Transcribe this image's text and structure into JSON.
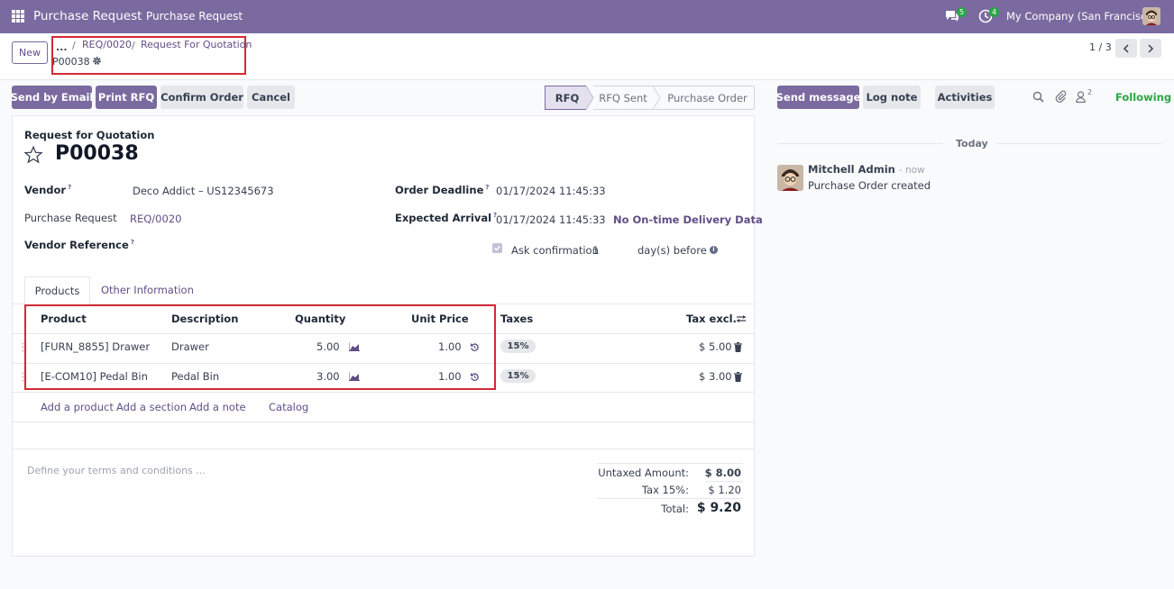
{
  "navbar": {
    "app_title": "Purchase Request",
    "menu_item": "Purchase Request",
    "chat_count": "5",
    "activity_count": "4",
    "company": "My Company (San Francisco)",
    "color": "#7a6a9f"
  },
  "control": {
    "new_label": "New",
    "breadcrumb_dots": "...",
    "breadcrumb_sep": "/",
    "breadcrumb_req": "REQ/0020",
    "breadcrumb_rfq": "Request For Quotation",
    "current_record": "P00038",
    "pager": "1 / 3"
  },
  "actions": {
    "send_email": "Send by Email",
    "print_rfq": "Print RFQ",
    "confirm_order": "Confirm Order",
    "cancel": "Cancel"
  },
  "stages": [
    "RFQ",
    "RFQ Sent",
    "Purchase Order"
  ],
  "form": {
    "subtitle": "Request for Quotation",
    "title": "P00038",
    "vendor_label": "Vendor",
    "vendor_value": "Deco Addict – US12345673",
    "purchase_request_label": "Purchase Request",
    "purchase_request_value": "REQ/0020",
    "vendor_reference_label": "Vendor Reference",
    "order_deadline_label": "Order Deadline",
    "order_deadline_value": "01/17/2024 11:45:33",
    "expected_arrival_label": "Expected Arrival",
    "expected_arrival_value": "01/17/2024 11:45:33",
    "delivery_data_link": "No On-time Delivery Data",
    "ask_confirmation_label": "Ask confirmation",
    "ask_confirmation_days": "1",
    "days_before": "day(s) before",
    "help_mark": "?"
  },
  "tabs": {
    "products": "Products",
    "other_info": "Other Information"
  },
  "table": {
    "headers": {
      "product": "Product",
      "description": "Description",
      "quantity": "Quantity",
      "unit_price": "Unit Price",
      "taxes": "Taxes",
      "tax_excl": "Tax excl."
    },
    "rows": [
      {
        "product": "[FURN_8855] Drawer",
        "description": "Drawer",
        "quantity": "5.00",
        "unit_price": "1.00",
        "tax": "15%",
        "subtotal": "$ 5.00"
      },
      {
        "product": "[E-COM10] Pedal Bin",
        "description": "Pedal Bin",
        "quantity": "3.00",
        "unit_price": "1.00",
        "tax": "15%",
        "subtotal": "$ 3.00"
      }
    ],
    "add_product": "Add a product",
    "add_section": "Add a section",
    "add_note": "Add a note",
    "catalog": "Catalog"
  },
  "terms_placeholder": "Define your terms and conditions ...",
  "totals": {
    "untaxed_label": "Untaxed Amount:",
    "untaxed_value": "$ 8.00",
    "tax_label": "Tax 15%:",
    "tax_value": "$ 1.20",
    "total_label": "Total:",
    "total_value": "$ 9.20"
  },
  "chatter": {
    "send_message": "Send message",
    "log_note": "Log note",
    "activities": "Activities",
    "followers_count": "2",
    "following": "Following",
    "today": "Today",
    "author": "Mitchell Admin",
    "time": "- now",
    "message": "Purchase Order created"
  }
}
